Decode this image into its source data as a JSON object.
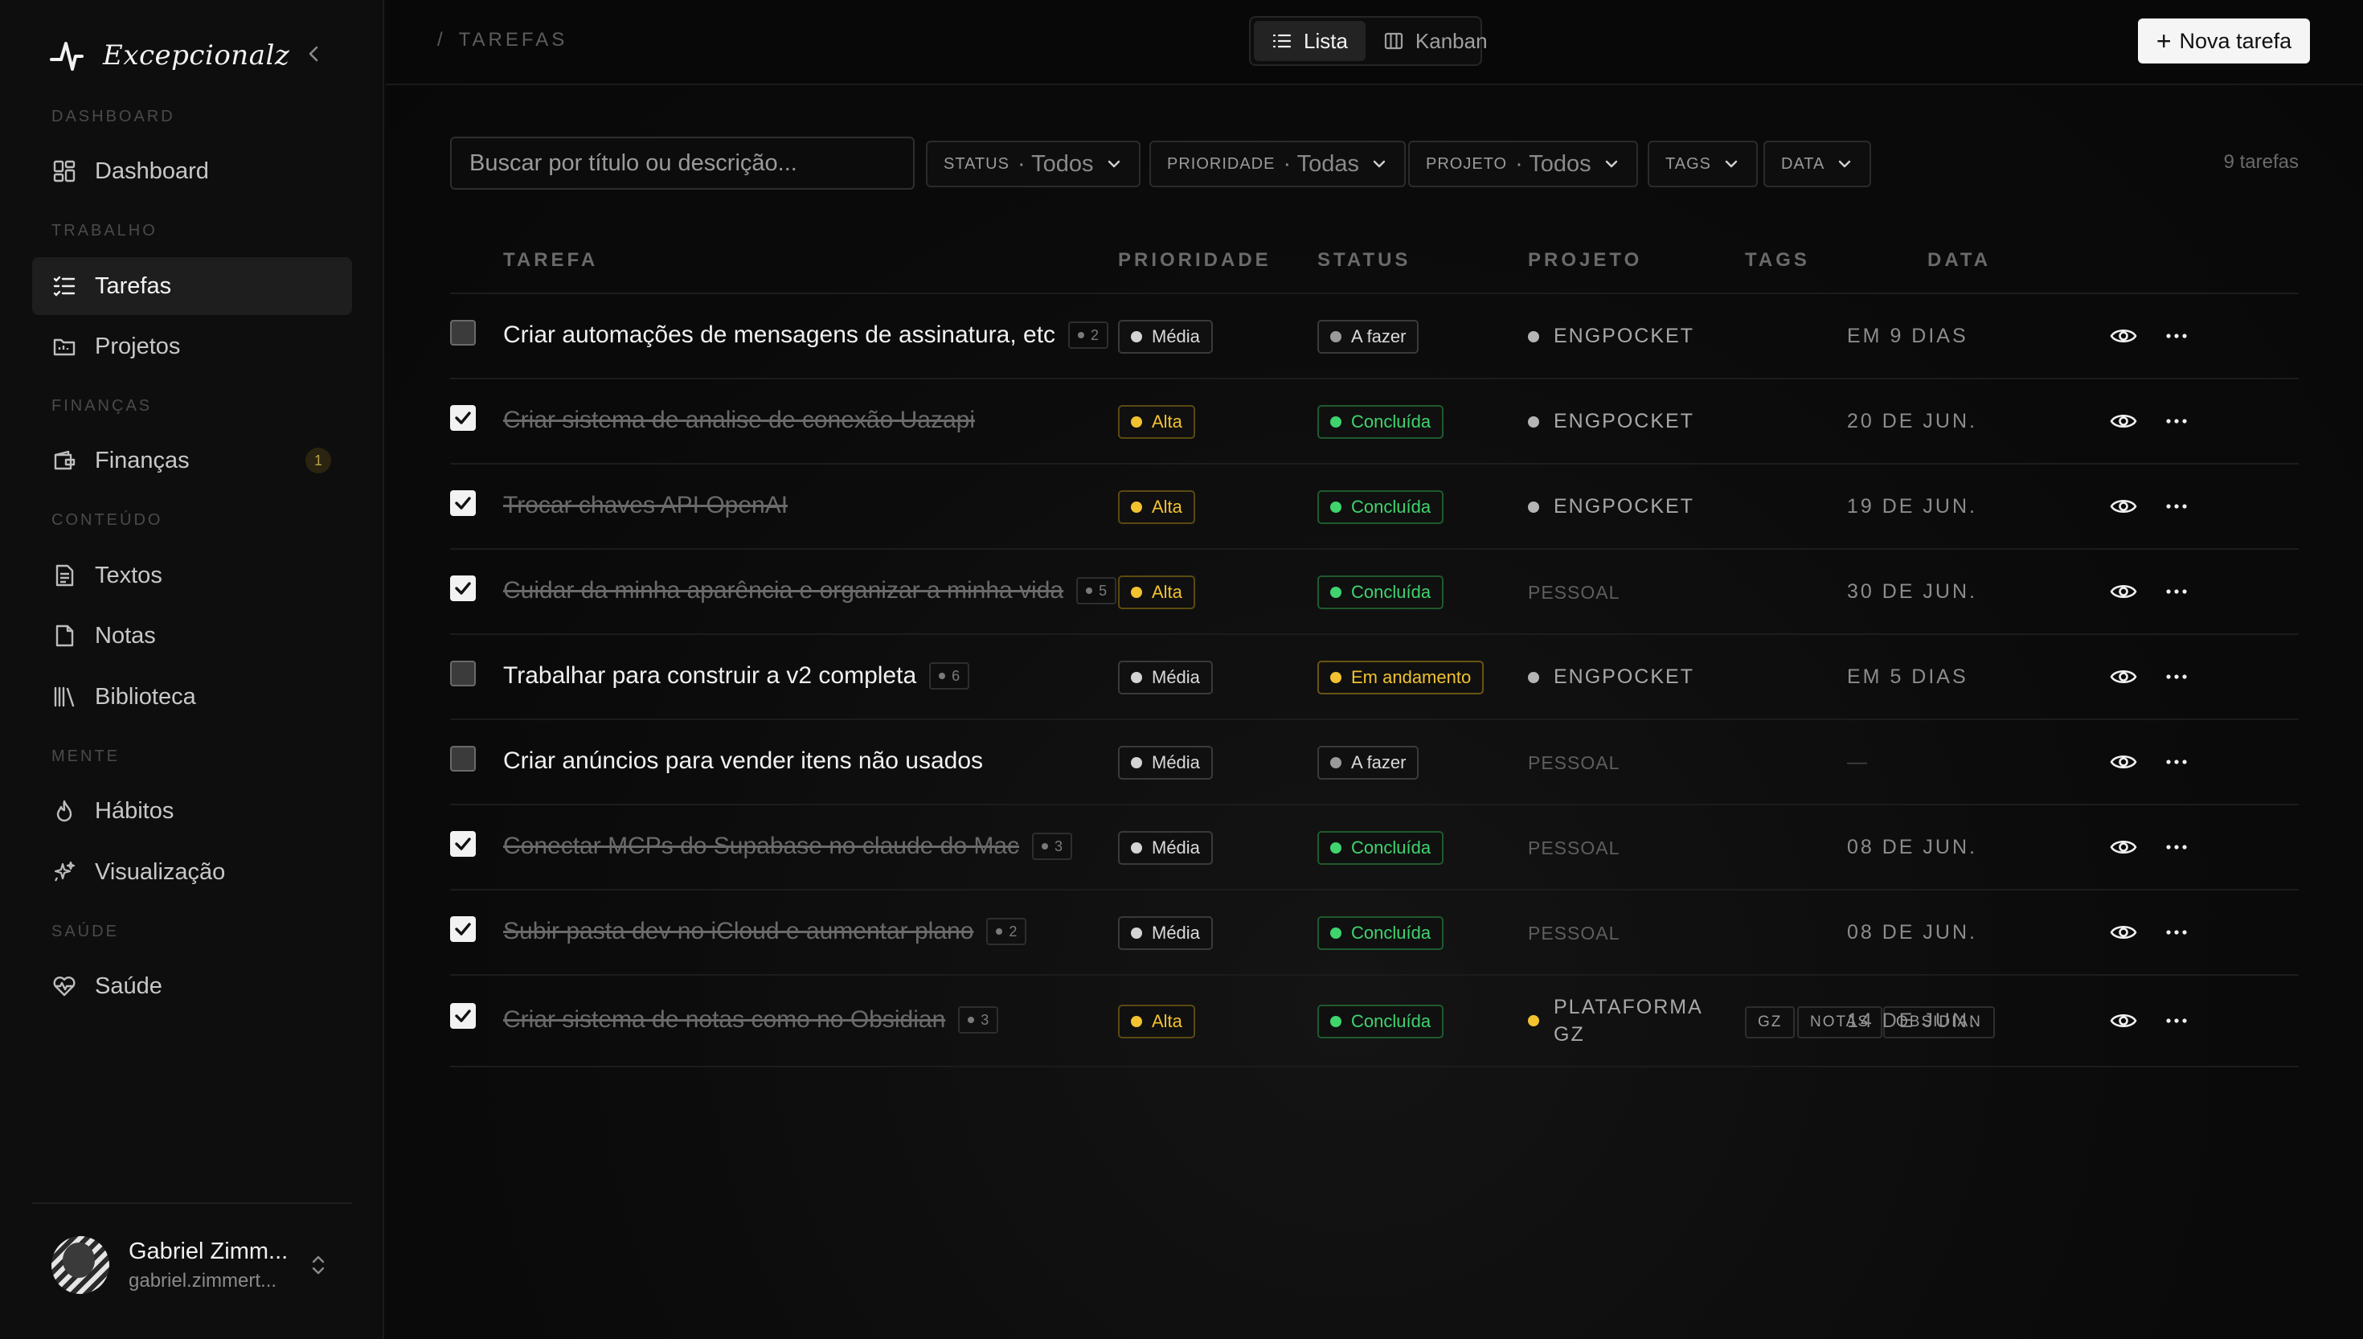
{
  "brand": {
    "name": "Excepcionalz"
  },
  "sidebar": {
    "sections": [
      {
        "label": "Dashboard"
      },
      {
        "label": "Trabalho"
      },
      {
        "label": "Finanças"
      },
      {
        "label": "Conteúdo"
      },
      {
        "label": "Mente"
      },
      {
        "label": "Saúde"
      }
    ],
    "items": [
      {
        "label": "Dashboard",
        "icon": "dashboard-icon"
      },
      {
        "label": "Tarefas",
        "icon": "tasks-icon",
        "active": true
      },
      {
        "label": "Projetos",
        "icon": "folder-icon"
      },
      {
        "label": "Finanças",
        "icon": "wallet-icon",
        "badge": "1"
      },
      {
        "label": "Textos",
        "icon": "document-icon"
      },
      {
        "label": "Notas",
        "icon": "note-icon"
      },
      {
        "label": "Biblioteca",
        "icon": "library-icon"
      },
      {
        "label": "Hábitos",
        "icon": "flame-icon"
      },
      {
        "label": "Visualização",
        "icon": "sparkles-icon"
      },
      {
        "label": "Saúde",
        "icon": "heart-pulse-icon"
      }
    ],
    "user": {
      "name": "Gabriel Zimm...",
      "email": "gabriel.zimmert..."
    }
  },
  "topbar": {
    "breadcrumb_sep": "/",
    "breadcrumb": "TAREFAS",
    "views": [
      {
        "label": "Lista",
        "active": true
      },
      {
        "label": "Kanban"
      }
    ],
    "new_task": "Nova tarefa"
  },
  "filters": {
    "search_placeholder": "Buscar por título ou descrição...",
    "status": {
      "label": "Status",
      "value": "· Todos"
    },
    "priority": {
      "label": "Prioridade",
      "value": "· Todas"
    },
    "project": {
      "label": "Projeto",
      "value": "· Todos"
    },
    "tags": {
      "label": "Tags"
    },
    "date": {
      "label": "Data"
    },
    "count": "9 tarefas"
  },
  "table": {
    "headers": {
      "task": "TAREFA",
      "priority": "PRIORIDADE",
      "status": "STATUS",
      "project": "PROJETO",
      "tags": "TAGS",
      "date": "DATA"
    },
    "rows": [
      {
        "title": "Criar automações de mensagens de assinatura, etc",
        "sub": "2",
        "done": false,
        "priority": "Média",
        "status": "A fazer",
        "project": "ENGPOCKET",
        "date": "EM 9 DIAS"
      },
      {
        "title": "Criar sistema de analise de conexão Uazapi",
        "sub": "",
        "done": true,
        "priority": "Alta",
        "status": "Concluída",
        "project": "ENGPOCKET",
        "date": "20 DE JUN."
      },
      {
        "title": "Trocar chaves API OpenAI",
        "sub": "",
        "done": true,
        "priority": "Alta",
        "status": "Concluída",
        "project": "ENGPOCKET",
        "date": "19 DE JUN."
      },
      {
        "title": "Cuidar da minha aparência e organizar a minha vida",
        "sub": "5",
        "done": true,
        "priority": "Alta",
        "status": "Concluída",
        "project": "PESSOAL",
        "date": "30 DE JUN."
      },
      {
        "title": "Trabalhar para construir a v2 completa",
        "sub": "6",
        "done": false,
        "priority": "Média",
        "status": "Em andamento",
        "project": "ENGPOCKET",
        "date": "EM 5 DIAS"
      },
      {
        "title": "Criar anúncios para vender itens não usados",
        "sub": "",
        "done": false,
        "priority": "Média",
        "status": "A fazer",
        "project": "PESSOAL",
        "date": "—"
      },
      {
        "title": "Conectar MCPs do Supabase no claude do Mac",
        "sub": "3",
        "done": true,
        "priority": "Média",
        "status": "Concluída",
        "project": "PESSOAL",
        "date": "08 DE JUN."
      },
      {
        "title": "Subir pasta dev no iCloud e aumentar plano",
        "sub": "2",
        "done": true,
        "priority": "Média",
        "status": "Concluída",
        "project": "PESSOAL",
        "date": "08 DE JUN."
      },
      {
        "title": "Criar sistema de notas como no Obsidian",
        "sub": "3",
        "done": true,
        "priority": "Alta",
        "status": "Concluída",
        "project_line1": "PLATAFORMA",
        "project_line2": "GZ",
        "tags": [
          "GZ",
          "NOTAS",
          "OBSIDIAN"
        ],
        "date": "14 DE JUN."
      }
    ]
  },
  "colors": {
    "accent_yellow": "#f2c230",
    "done_green": "#3fd46e",
    "background": "#0a0a0a"
  }
}
